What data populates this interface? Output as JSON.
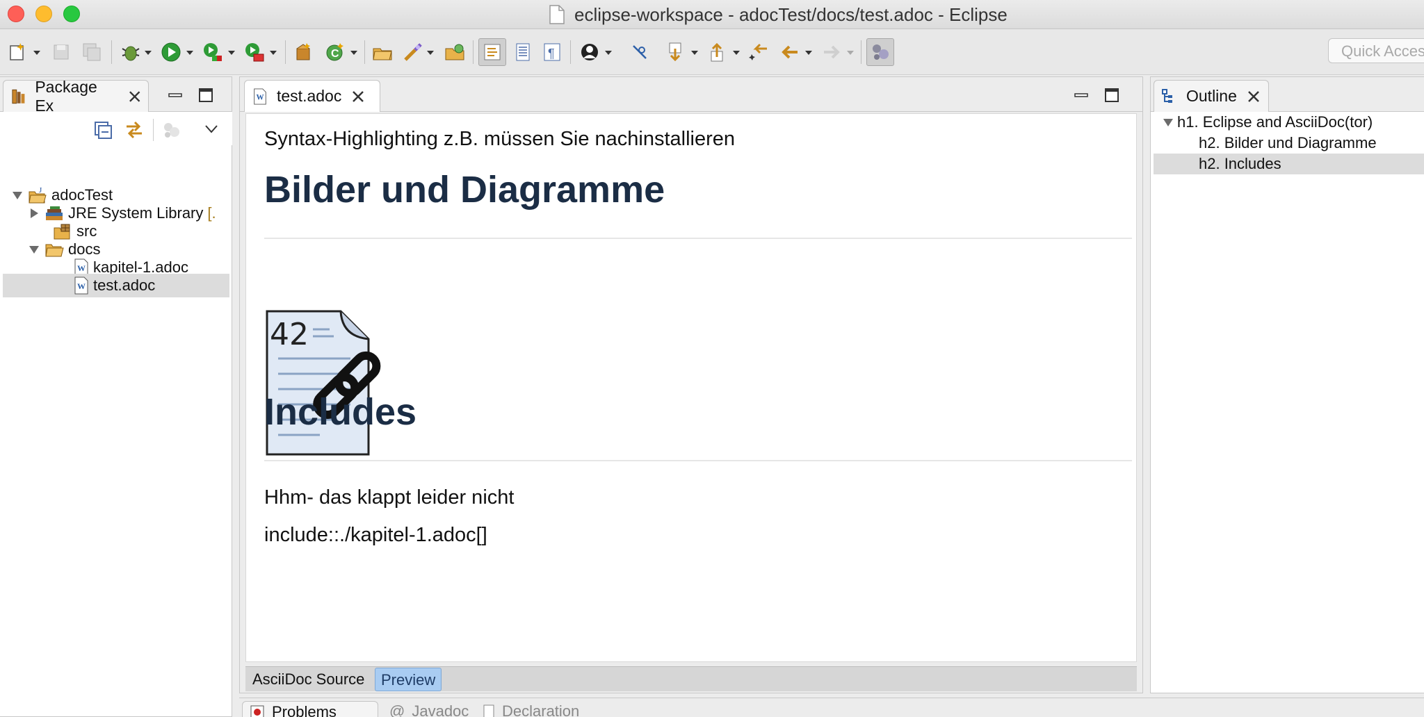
{
  "window": {
    "title": "eclipse-workspace - adocTest/docs/test.adoc - Eclipse"
  },
  "toolbar": {
    "quick_access_placeholder": "Quick Access",
    "icons": [
      "new-icon",
      "save-icon",
      "save-all-icon",
      "debug-icon",
      "run-icon",
      "coverage-icon",
      "external-tools-icon",
      "new-package-icon",
      "new-class-icon",
      "open-type-icon",
      "search-icon",
      "open-task-icon",
      "toggle-mark-occurrences-icon",
      "toggle-block-icon",
      "show-whitespace-icon",
      "team-icon",
      "pin-icon",
      "next-annotation-icon",
      "previous-annotation-icon",
      "last-edit-icon",
      "back-icon",
      "forward-icon",
      "perspective-icon"
    ]
  },
  "package_explorer": {
    "tab_label": "Package Ex",
    "tree": [
      {
        "label": "adocTest",
        "icon": "java-project-icon",
        "expanded": true
      },
      {
        "label": "JRE System Library",
        "suffix": "[.",
        "icon": "library-icon",
        "expanded": false
      },
      {
        "label": "src",
        "icon": "source-folder-icon"
      },
      {
        "label": "docs",
        "icon": "folder-icon",
        "expanded": true
      },
      {
        "label": "kapitel-1.adoc",
        "icon": "adoc-file-icon"
      },
      {
        "label": "test.adoc",
        "icon": "adoc-file-icon",
        "selected": true
      }
    ]
  },
  "editor": {
    "tab_label": "test.adoc",
    "preview": {
      "intro_line": "Syntax-Highlighting z.B. müssen Sie nachinstallieren",
      "heading_1": "Bilder und Diagramme",
      "image_number": "42",
      "heading_2": "Includes",
      "paragraph_1": "Hhm- das klappt leider nicht",
      "paragraph_2": "include::./kapitel-1.adoc[]"
    },
    "bottom_tabs": [
      "AsciiDoc Source",
      "Preview"
    ],
    "active_bottom_tab": "Preview"
  },
  "outline": {
    "tab_label": "Outline",
    "items": [
      {
        "label": "h1. Eclipse and AsciiDoc(tor)",
        "level": 1,
        "expanded": true
      },
      {
        "label": "h2. Bilder und Diagramme",
        "level": 2
      },
      {
        "label": "h2. Includes",
        "level": 2,
        "selected": true
      }
    ]
  },
  "bottom_panel": {
    "tabs": [
      "Problems",
      "Javadoc",
      "Declaration"
    ]
  },
  "colors": {
    "heading": "#1b2d45",
    "selection": "#dcdcdc",
    "active_tab_blue": "#a9ccf2"
  }
}
